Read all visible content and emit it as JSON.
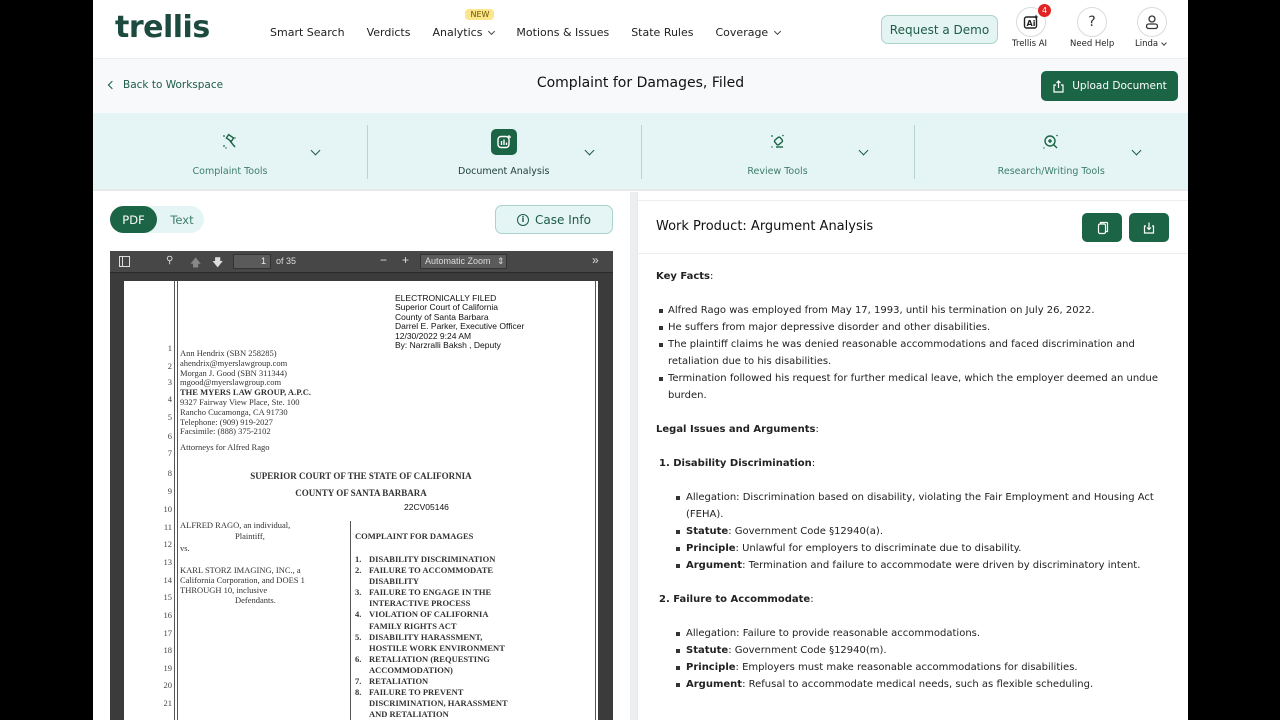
{
  "topnav": {
    "logo": "trellis",
    "links": [
      {
        "label": "Smart Search",
        "has_dropdown": false
      },
      {
        "label": "Verdicts",
        "has_dropdown": false
      },
      {
        "label": "Analytics",
        "has_dropdown": true,
        "badge": "NEW"
      },
      {
        "label": "Motions & Issues",
        "has_dropdown": false
      },
      {
        "label": "State Rules",
        "has_dropdown": false
      },
      {
        "label": "Coverage",
        "has_dropdown": true
      }
    ],
    "demo_button": "Request a Demo",
    "trellis_ai": {
      "label": "Trellis AI",
      "icon": "ai-sparkle-icon",
      "notification_count": "4"
    },
    "help": {
      "label": "Need Help",
      "icon": "question-icon"
    },
    "user": {
      "label": "Linda",
      "icon": "user-icon"
    }
  },
  "subheader": {
    "back_label": "Back to Workspace",
    "title": "Complaint for Damages, Filed",
    "upload_label": "Upload Document"
  },
  "tools": [
    {
      "label": "Complaint Tools",
      "icon": "gavel-sparkle-icon",
      "active": false
    },
    {
      "label": "Document Analysis",
      "icon": "chart-sparkle-icon",
      "active": true
    },
    {
      "label": "Review Tools",
      "icon": "eraser-sparkle-icon",
      "active": false
    },
    {
      "label": "Research/Writing Tools",
      "icon": "search-plus-icon",
      "active": false
    }
  ],
  "left": {
    "toggle": {
      "pdf": "PDF",
      "text": "Text",
      "selected": "PDF"
    },
    "case_info": "Case Info",
    "pdf_toolbar": {
      "page": "1",
      "of_pages": "of 35",
      "zoom": "Automatic Zoom"
    },
    "pdf": {
      "filed_stamp": [
        "ELECTRONICALLY FILED",
        "Superior Court of California",
        "County of Santa Barbara",
        "Darrel E. Parker, Executive Officer",
        "12/30/2022 9:24 AM",
        "By: Narzralli Baksh , Deputy"
      ],
      "attorney_block": [
        "Ann Hendrix (SBN 258285)",
        "ahendrix@myerslawgroup.com",
        "Morgan J. Good (SBN 311344)",
        "mgood@myerslawgroup.com",
        "THE MYERS LAW GROUP, A.P.C.",
        "9327 Fairway View Place, Ste. 100",
        "Rancho Cucamonga, CA 91730",
        "Telephone: (909) 919-2027",
        "Facsimile: (888) 375-2102"
      ],
      "attorneys_for": "Attorneys for Alfred Rago",
      "court": "SUPERIOR COURT OF THE STATE OF CALIFORNIA",
      "county": "COUNTY OF SANTA BARBARA",
      "case_number": "22CV05146",
      "plaintiff": "ALFRED RAGO, an individual,",
      "plaintiff_role": "Plaintiff,",
      "vs": "vs.",
      "defendant_lines": [
        "KARL STORZ IMAGING, INC., a",
        "California Corporation, and DOES 1",
        "THROUGH 10, inclusive"
      ],
      "defendant_role": "Defendants.",
      "complaint_title": "COMPLAINT FOR DAMAGES",
      "causes": [
        [
          "1.",
          "DISABILITY DISCRIMINATION"
        ],
        [
          "2.",
          "FAILURE TO ACCOMMODATE"
        ],
        [
          "",
          "DISABILITY"
        ],
        [
          "3.",
          "FAILURE TO ENGAGE IN THE"
        ],
        [
          "",
          "INTERACTIVE PROCESS"
        ],
        [
          "4.",
          "VIOLATION OF CALIFORNIA"
        ],
        [
          "",
          "FAMILY RIGHTS ACT"
        ],
        [
          "5.",
          "DISABILITY HARASSMENT,"
        ],
        [
          "",
          "HOSTILE WORK ENVIRONMENT"
        ],
        [
          "6.",
          "RETALIATION (REQUESTING"
        ],
        [
          "",
          "ACCOMMODATION)"
        ],
        [
          "7.",
          "RETALIATION"
        ],
        [
          "8.",
          "FAILURE TO PREVENT"
        ],
        [
          "",
          "DISCRIMINATION, HARASSMENT"
        ],
        [
          "",
          "AND RETALIATION"
        ]
      ],
      "line_numbers": [
        "1",
        "2",
        "3",
        "4",
        "5",
        "6",
        "7",
        "8",
        "9",
        "10",
        "11",
        "12",
        "13",
        "14",
        "15",
        "16",
        "17",
        "18",
        "19",
        "20",
        "21"
      ]
    }
  },
  "right": {
    "title": "Work Product: Argument Analysis",
    "copy_icon": "copy-icon",
    "download_icon": "download-icon",
    "key_facts_heading": "Key Facts",
    "key_facts": [
      "Alfred Rago was employed from May 17, 1993, until his termination on July 26, 2022.",
      "He suffers from major depressive disorder and other disabilities.",
      "The plaintiff claims he was denied reasonable accommodations and faced discrimination and retaliation due to his disabilities.",
      "Termination followed his request for further medical leave, which the employer deemed an undue burden."
    ],
    "legal_heading": "Legal Issues and Arguments",
    "issues": [
      {
        "heading": "1. Disability Discrimination",
        "allegation": "Allegation: Discrimination based on disability, violating the Fair Employment and Housing Act (FEHA).",
        "statute_label": "Statute",
        "statute": ": Government Code §12940(a).",
        "principle_label": "Principle",
        "principle": ": Unlawful for employers to discriminate due to disability.",
        "argument_label": "Argument",
        "argument": ": Termination and failure to accommodate were driven by discriminatory intent."
      },
      {
        "heading": "2. Failure to Accommodate",
        "allegation": "Allegation: Failure to provide reasonable accommodations.",
        "statute_label": "Statute",
        "statute": ": Government Code §12940(m).",
        "principle_label": "Principle",
        "principle": ": Employers must make reasonable accommodations for disabilities.",
        "argument_label": "Argument",
        "argument": ": Refusal to accommodate medical needs, such as flexible scheduling."
      }
    ]
  },
  "colors": {
    "brand_green": "#1b6445",
    "logo_green": "#1d4a3e",
    "tools_bg": "#e5f4f4",
    "badge_yellow": "#fde58a",
    "notification_red": "#e02424"
  }
}
